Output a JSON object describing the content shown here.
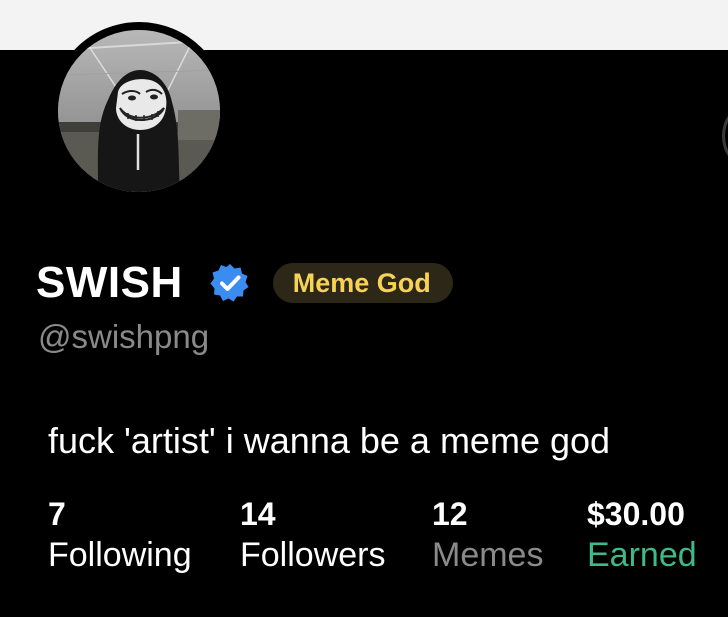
{
  "profile": {
    "display_name": "SWISH",
    "handle": "@swishpng",
    "badge": "Meme God",
    "bio": "fuck 'artist' i wanna be a meme god",
    "verified": true,
    "avatar_icon": "trollface-hooded-avatar"
  },
  "stats": [
    {
      "value": "7",
      "label": "Following",
      "color": "#ffffff"
    },
    {
      "value": "14",
      "label": "Followers",
      "color": "#ffffff"
    },
    {
      "value": "12",
      "label": "Memes",
      "color": "#8a8a8a"
    },
    {
      "value": "$30.00",
      "label": "Earned",
      "color": "#3fb985"
    }
  ],
  "colors": {
    "background": "#000000",
    "badge_bg": "#2c2717",
    "badge_text": "#f7d257",
    "verified_blue": "#3b8cf0",
    "earned_green": "#3fb985",
    "muted": "#8a8a8a"
  }
}
